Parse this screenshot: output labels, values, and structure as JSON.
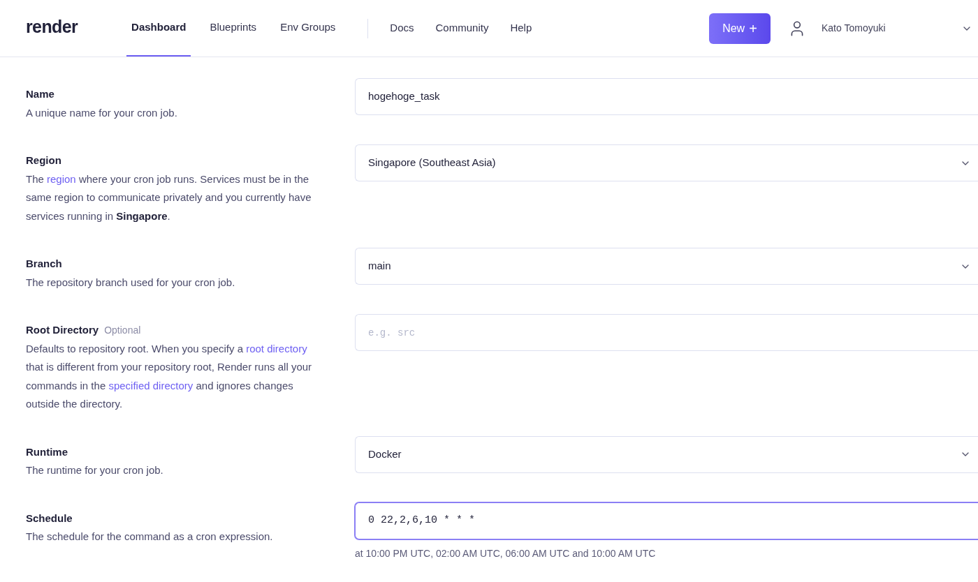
{
  "header": {
    "logo": "render",
    "nav": [
      {
        "label": "Dashboard",
        "selected": true
      },
      {
        "label": "Blueprints",
        "selected": false
      },
      {
        "label": "Env Groups",
        "selected": false
      }
    ],
    "links": [
      "Docs",
      "Community",
      "Help"
    ],
    "new_button": {
      "label": "New",
      "icon": "+"
    },
    "user": {
      "name": "Kato Tomoyuki"
    }
  },
  "fields": [
    {
      "label": "Name",
      "kind": "text",
      "focused": false,
      "value": "hogehoge_task",
      "description": [
        {
          "kind": "text",
          "text": "A unique name for your cron job."
        }
      ]
    },
    {
      "label": "Region",
      "kind": "select",
      "focused": false,
      "value": "Singapore (Southeast Asia)",
      "description": [
        {
          "kind": "text",
          "text": "The "
        },
        {
          "kind": "link",
          "text": "region"
        },
        {
          "kind": "text",
          "text": " where your cron job runs. Services must be in the same region to communicate privately and you currently have services running in **Singapore**."
        }
      ]
    },
    {
      "label": "Branch",
      "kind": "select",
      "focused": false,
      "value": "main",
      "description": [
        {
          "kind": "text",
          "text": "The repository branch used for your cron job."
        }
      ]
    },
    {
      "label": "Root Directory",
      "optional": "Optional",
      "kind": "mono",
      "focused": false,
      "placeholder": "e.g. src",
      "description": [
        {
          "kind": "text",
          "text": "Defaults to repository root. When you specify a "
        },
        {
          "kind": "link",
          "text": "root directory"
        },
        {
          "kind": "text",
          "text": " that is different from your repository root, Render runs all your commands in the "
        },
        {
          "kind": "link",
          "text": "specified directory"
        },
        {
          "kind": "text",
          "text": " and ignores changes outside the directory."
        }
      ]
    },
    {
      "label": "Runtime",
      "kind": "select",
      "focused": false,
      "value": "Docker",
      "description": [
        {
          "kind": "text",
          "text": "The runtime for your cron job."
        }
      ]
    },
    {
      "label": "Schedule",
      "kind": "mono",
      "value": "0 22,2,6,10 * * *",
      "focused": true,
      "hint": "at 10:00 PM UTC, 02:00 AM UTC, 06:00 AM UTC and 10:00 AM UTC",
      "description": [
        {
          "kind": "text",
          "text": "The schedule for the command as a cron expression."
        }
      ]
    }
  ]
}
